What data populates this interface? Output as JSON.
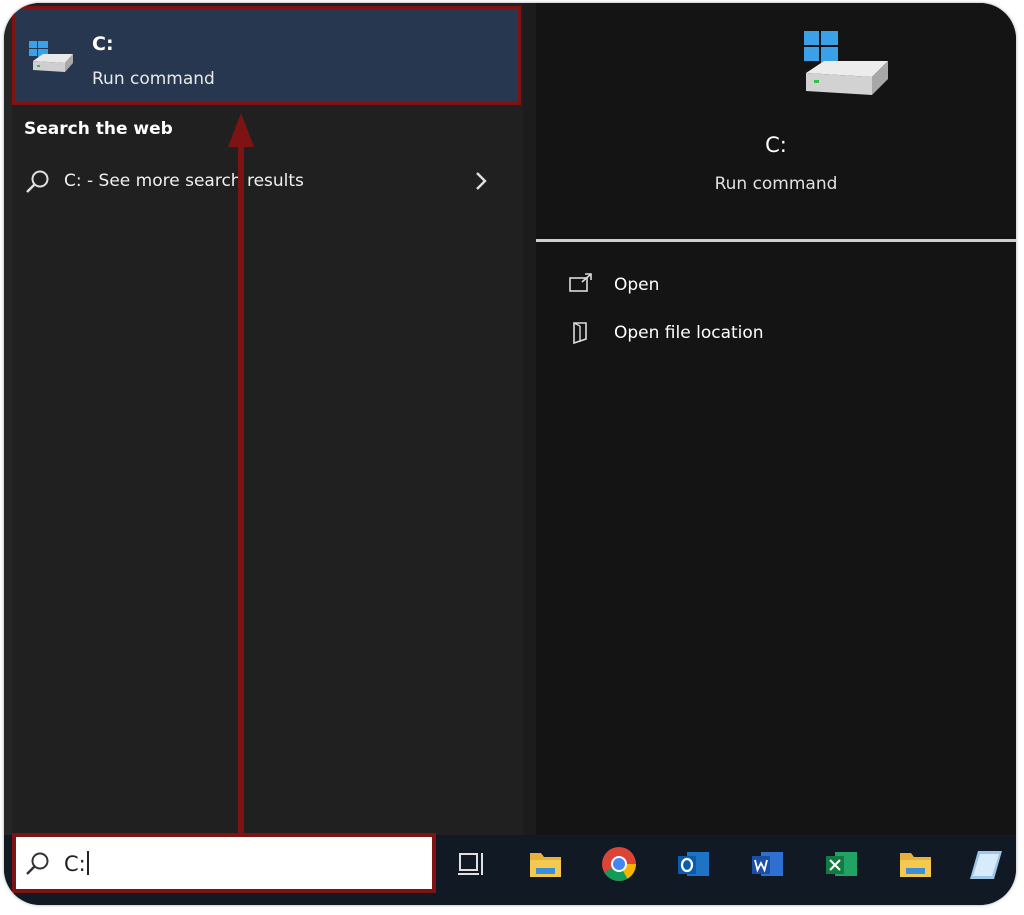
{
  "best_match": {
    "title": "C:",
    "subtitle": "Run command"
  },
  "web_section": {
    "header": "Search the web",
    "item": {
      "text": "C: - See more search results"
    }
  },
  "preview": {
    "title": "C:",
    "subtitle": "Run command",
    "actions": [
      {
        "label": "Open",
        "icon": "open-icon"
      },
      {
        "label": "Open file location",
        "icon": "file-location-icon"
      }
    ]
  },
  "search": {
    "value": "C:"
  },
  "taskbar": {
    "items": [
      "task-view-icon",
      "file-explorer-icon",
      "chrome-icon",
      "outlook-icon",
      "word-icon",
      "excel-icon",
      "folder-icon",
      "notepad-icon"
    ]
  },
  "colors": {
    "highlight_border": "#7e1313",
    "selected_bg": "#27374f",
    "panel_bg": "#202020",
    "preview_bg": "#141414",
    "taskbar_bg": "#101924"
  }
}
